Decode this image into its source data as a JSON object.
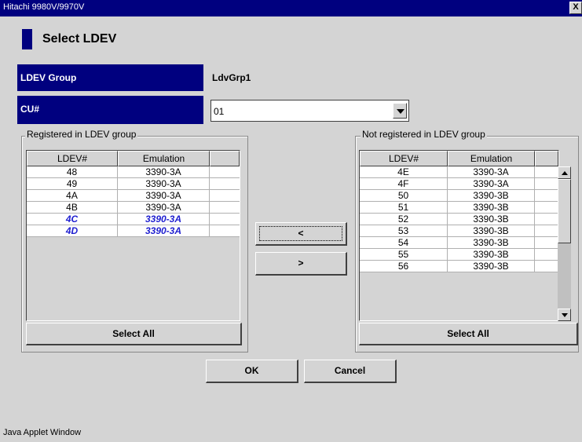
{
  "window": {
    "title": "Hitachi 9980V/9970V",
    "close_label": "X"
  },
  "heading": "Select LDEV",
  "ldev_group": {
    "label": "LDEV Group",
    "value": "LdvGrp1"
  },
  "cu": {
    "label": "CU#",
    "value": "01"
  },
  "registered": {
    "title": "Registered in LDEV group",
    "columns": [
      "LDEV#",
      "Emulation"
    ],
    "rows": [
      {
        "ldev": "48",
        "emulation": "3390-3A",
        "selected": false
      },
      {
        "ldev": "49",
        "emulation": "3390-3A",
        "selected": false
      },
      {
        "ldev": "4A",
        "emulation": "3390-3A",
        "selected": false
      },
      {
        "ldev": "4B",
        "emulation": "3390-3A",
        "selected": false
      },
      {
        "ldev": "4C",
        "emulation": "3390-3A",
        "selected": true
      },
      {
        "ldev": "4D",
        "emulation": "3390-3A",
        "selected": true
      }
    ],
    "select_all_label": "Select All"
  },
  "not_registered": {
    "title": "Not registered in LDEV group",
    "columns": [
      "LDEV#",
      "Emulation"
    ],
    "rows": [
      {
        "ldev": "4E",
        "emulation": "3390-3A"
      },
      {
        "ldev": "4F",
        "emulation": "3390-3A"
      },
      {
        "ldev": "50",
        "emulation": "3390-3B"
      },
      {
        "ldev": "51",
        "emulation": "3390-3B"
      },
      {
        "ldev": "52",
        "emulation": "3390-3B"
      },
      {
        "ldev": "53",
        "emulation": "3390-3B"
      },
      {
        "ldev": "54",
        "emulation": "3390-3B"
      },
      {
        "ldev": "55",
        "emulation": "3390-3B"
      },
      {
        "ldev": "56",
        "emulation": "3390-3B"
      }
    ],
    "select_all_label": "Select All"
  },
  "move_buttons": {
    "to_registered": "<",
    "to_not_registered": ">"
  },
  "actions": {
    "ok": "OK",
    "cancel": "Cancel"
  },
  "footer": "Java Applet Window",
  "colors": {
    "title_bar": "#00007f",
    "label_bar": "#00007f",
    "selected_text": "#1f1fd0",
    "background": "#d4d4d4"
  }
}
